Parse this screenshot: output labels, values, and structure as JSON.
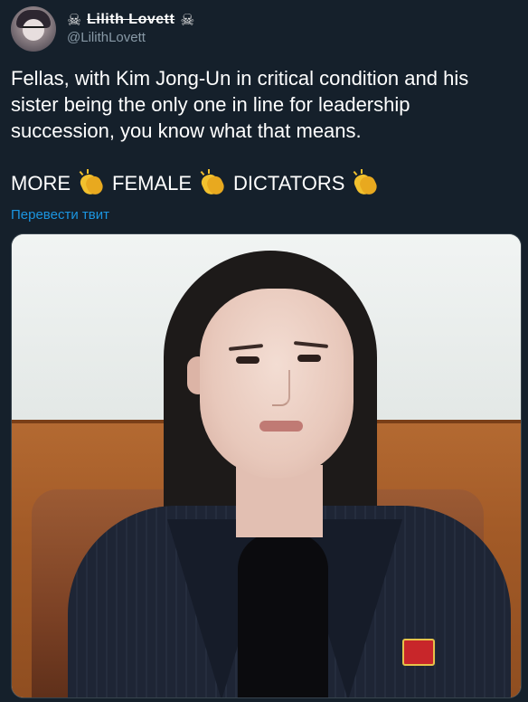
{
  "user": {
    "display_name": "Lilith Lovett",
    "name_prefix_icon": "skull-crossbones-icon",
    "name_suffix_icon": "skull-crossbones-icon",
    "handle": "@LilithLovett",
    "avatar_icon": "avatar-illustration"
  },
  "tweet": {
    "text_line1": "Fellas, with Kim Jong-Un in critical condition and his sister being the only one in line for leadership succession, you know what that means.",
    "emphasis": {
      "word1": "MORE",
      "word2": "FEMALE",
      "word3": "DICTATORS",
      "icon": "clapping-hands-icon"
    },
    "translate_label": "Перевести твит"
  },
  "media": {
    "type": "photo"
  },
  "colors": {
    "background": "#15202b",
    "text": "#ffffff",
    "secondary_text": "#8899a6",
    "link": "#1b95e0"
  }
}
